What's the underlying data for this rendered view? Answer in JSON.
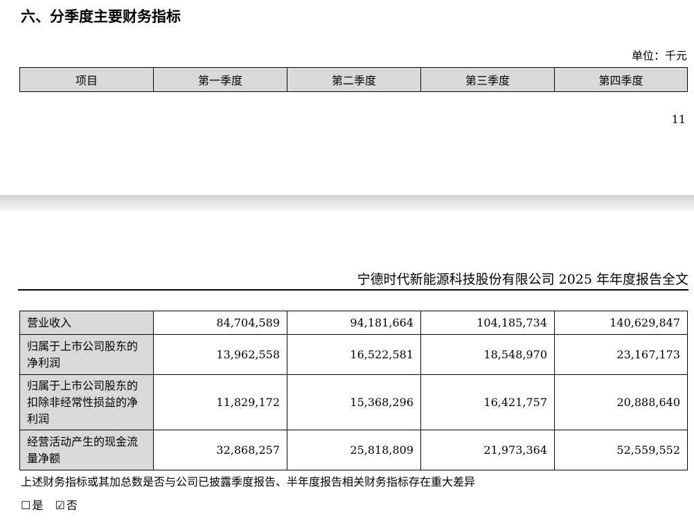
{
  "section_title": "六、分季度主要财务指标",
  "unit_label": "单位：千元",
  "table": {
    "headers": [
      "项目",
      "第一季度",
      "第二季度",
      "第三季度",
      "第四季度"
    ],
    "rows": [
      {
        "label": "营业收入",
        "values": [
          "84,704,589",
          "94,181,664",
          "104,185,734",
          "140,629,847"
        ]
      },
      {
        "label": "归属于上市公司股东的净利润",
        "values": [
          "13,962,558",
          "16,522,581",
          "18,548,970",
          "23,167,173"
        ]
      },
      {
        "label": "归属于上市公司股东的扣除非经常性损益的净利润",
        "values": [
          "11,829,172",
          "15,368,296",
          "16,421,757",
          "20,888,640"
        ]
      },
      {
        "label": "经营活动产生的现金流量净额",
        "values": [
          "32,868,257",
          "25,818,809",
          "21,973,364",
          "52,559,552"
        ]
      }
    ]
  },
  "page_number": "11",
  "running_header": "宁德时代新能源科技股份有限公司 2025 年年度报告全文",
  "footnote": "上述财务指标或其加总数是否与公司已披露季度报告、半年度报告相关财务指标存在重大差异",
  "options": {
    "yes_box": "☐",
    "yes_label": "是",
    "no_box": "☑",
    "no_label": "否"
  }
}
